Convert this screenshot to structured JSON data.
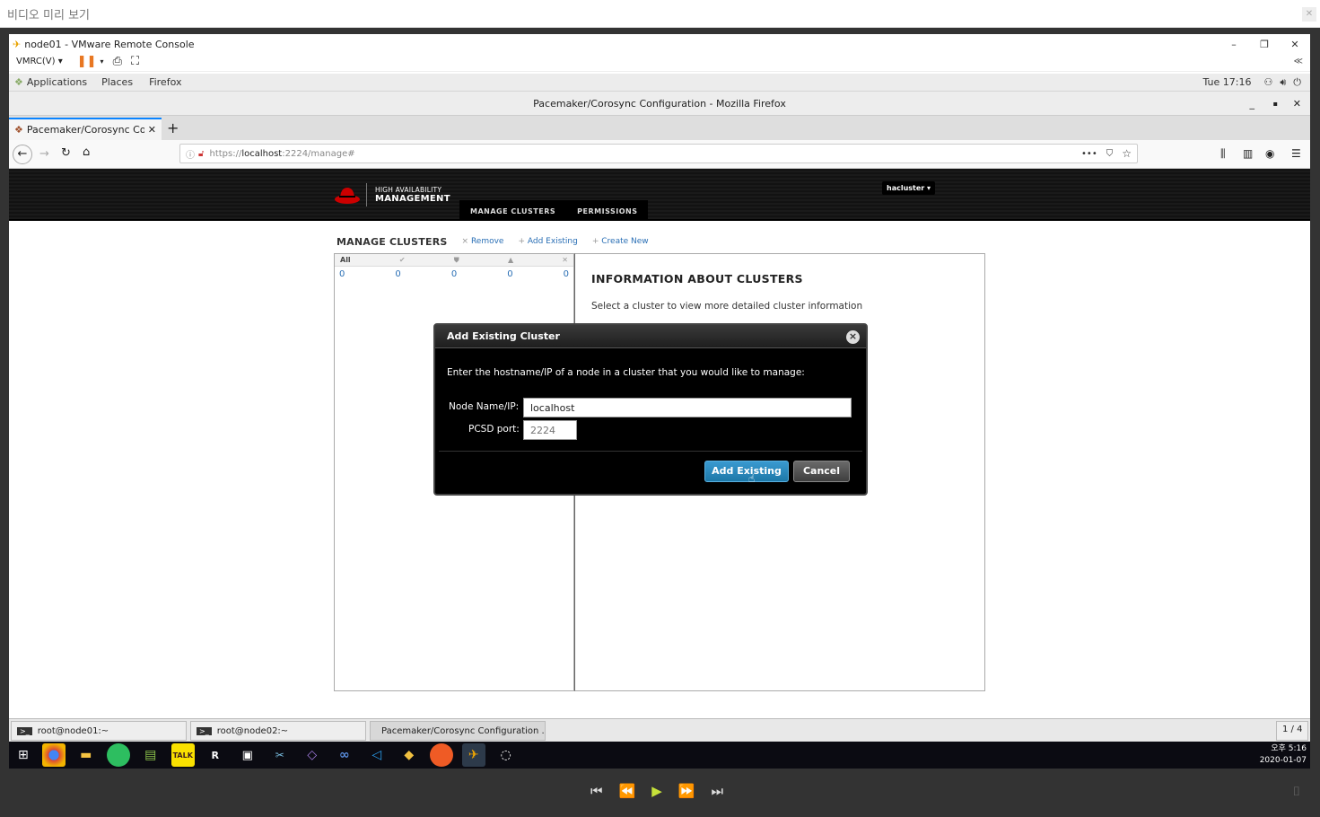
{
  "viewer": {
    "title": "비디오 미리 보기",
    "close": "✕",
    "counter": "1 / 4"
  },
  "vmrc": {
    "title": "node01 - VMware Remote Console",
    "menu": "VMRC(V)",
    "collapse": "≪",
    "minimize": "–",
    "restore": "❐",
    "close": "✕"
  },
  "gnome": {
    "applications": "Applications",
    "places": "Places",
    "firefox": "Firefox",
    "clock": "Tue 17:16"
  },
  "firefox": {
    "window_title": "Pacemaker/Corosync Configuration - Mozilla Firefox",
    "tab_label": "Pacemaker/Corosync Con",
    "new_tab": "+",
    "url_prefix": "https://",
    "url_host": "localhost",
    "url_rest": ":2224/manage#",
    "win_min": "_",
    "win_max": "▪",
    "win_close": "✕"
  },
  "app": {
    "brand_top": "HIGH AVAILABILITY",
    "brand_bottom": "MANAGEMENT",
    "nav": [
      "MANAGE CLUSTERS",
      "PERMISSIONS"
    ],
    "user_menu": "hacluster ▾"
  },
  "manage": {
    "heading": "MANAGE CLUSTERS",
    "actions": [
      {
        "icon": "×",
        "label": "Remove"
      },
      {
        "icon": "+",
        "label": "Add Existing"
      },
      {
        "icon": "+",
        "label": "Create New"
      }
    ],
    "filters": [
      {
        "label": "All",
        "count": "0"
      },
      {
        "label": "✔",
        "count": "0"
      },
      {
        "label": "⛊",
        "count": "0"
      },
      {
        "label": "▲",
        "count": "0"
      },
      {
        "label": "✕",
        "count": "0"
      }
    ]
  },
  "info": {
    "heading": "INFORMATION ABOUT CLUSTERS",
    "text": "Select a cluster to view more detailed cluster information"
  },
  "dialog": {
    "title": "Add Existing Cluster",
    "close": "×",
    "prompt": "Enter the hostname/IP of a node in a cluster that you would like to manage:",
    "node_label": "Node Name/IP:",
    "node_value": "localhost",
    "port_label": "PCSD port:",
    "port_placeholder": "2224",
    "add_button": "Add Existing",
    "cancel_button": "Cancel"
  },
  "vm_taskbar": {
    "tasks": [
      "root@node01:~",
      "root@node02:~",
      "Pacemaker/Corosync Configuration ..."
    ],
    "pager": "1 / 4"
  },
  "windows": {
    "time": "오후 5:16",
    "date": "2020-01-07"
  },
  "colors": {
    "primary_button": "#1d78a8",
    "redhat_red": "#cc0000",
    "link": "#2a6fb5"
  }
}
